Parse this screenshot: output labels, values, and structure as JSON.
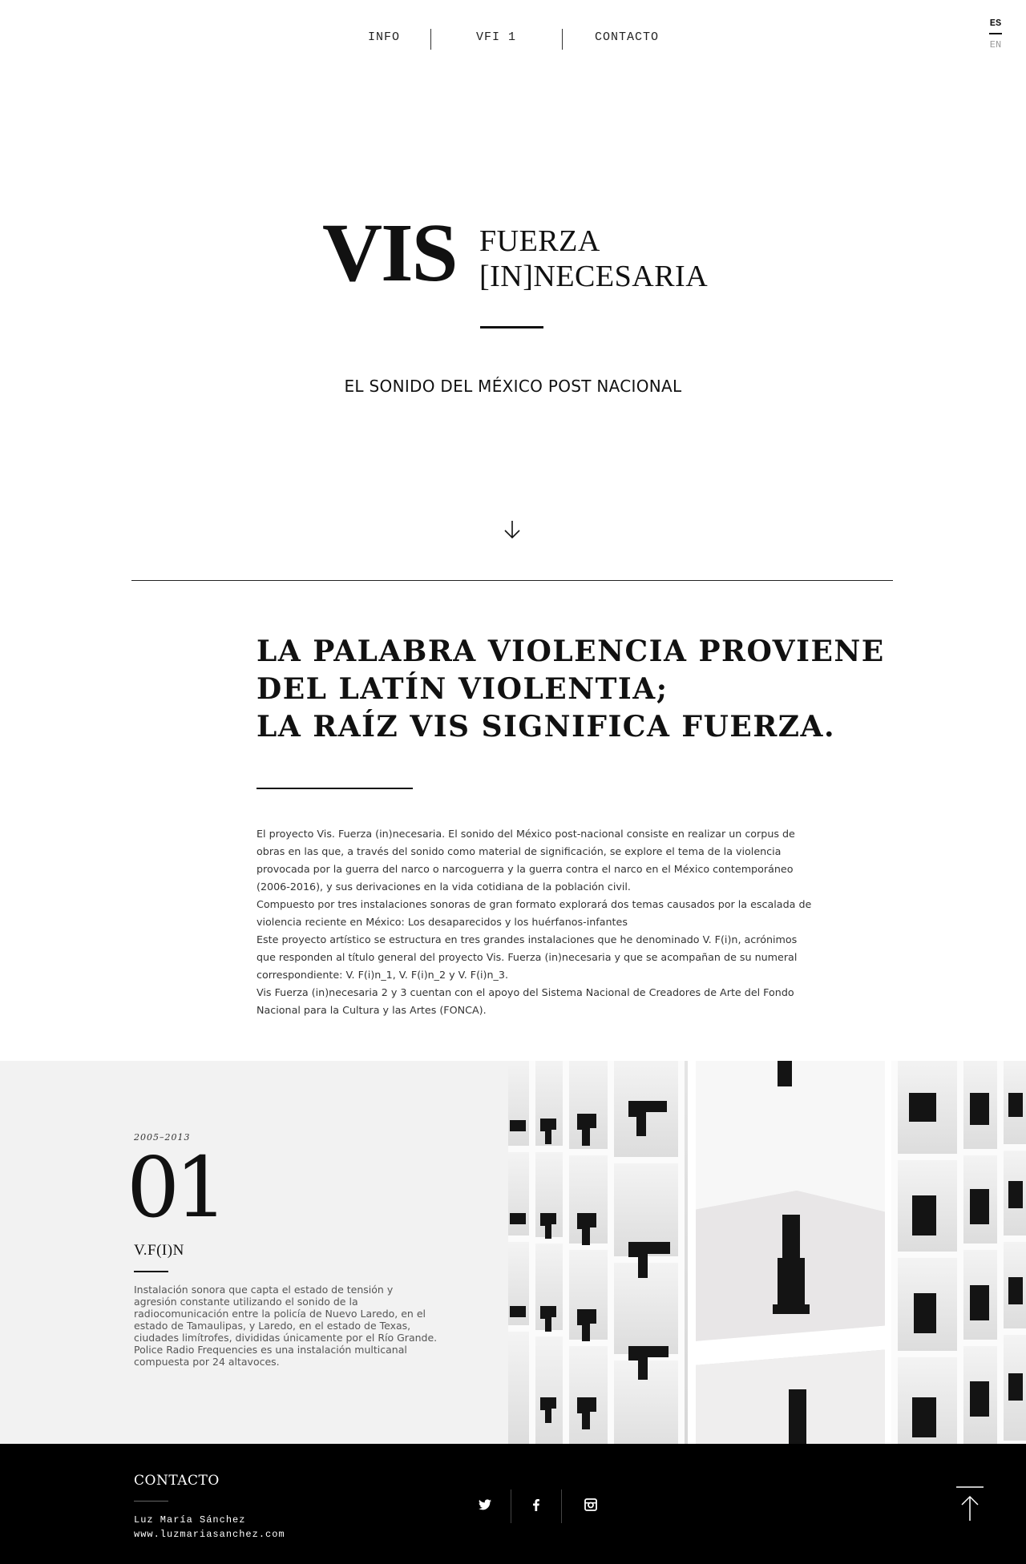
{
  "nav": {
    "items": [
      "INFO",
      "VFI 1",
      "CONTACTO"
    ]
  },
  "lang": {
    "active": "ES",
    "other": "EN"
  },
  "hero": {
    "vis": "VIS",
    "line1": "FUERZA",
    "line2": "[IN]NECESARIA",
    "tagline": "EL SONIDO DEL MÉXICO POST NACIONAL"
  },
  "quote": {
    "lines": [
      "LA PALABRA VIOLENCIA PROVIENE",
      "DEL LATÍN VIOLENTIA;",
      "LA RAÍZ VIS SIGNIFICA FUERZA."
    ]
  },
  "body": {
    "paragraphs": [
      "El proyecto Vis. Fuerza (in)necesaria. El sonido del México post-nacional consiste en realizar un corpus de obras en las que, a través del sonido como material de significación, se explore el tema de la violencia provocada por la guerra del narco o narcoguerra y la guerra contra el narco en el México contemporáneo (2006-2016), y sus derivaciones en la vida cotidiana de la población civil.",
      "Compuesto por tres instalaciones sonoras de gran formato explorará dos temas causados por la escalada de violencia reciente en México: Los desaparecidos y los huérfanos-infantes",
      "Este proyecto artístico se estructura en tres grandes instalaciones que he denominado V. F(i)n, acrónimos que responden al título general del proyecto Vis. Fuerza (in)necesaria y que se acompañan de su numeral correspondiente: V. F(i)n_1, V. F(i)n_2 y V. F(i)n_3.",
      "Vis Fuerza (in)necesaria 2 y 3 cuentan con el apoyo del Sistema Nacional de Creadores de Arte del Fondo Nacional para la Cultura y las Artes (FONCA)."
    ]
  },
  "project": {
    "years": "2005–2013",
    "number": "01",
    "title": "V.F(I)N",
    "description": "Instalación sonora que capta el estado de tensión y agresión constante utilizando el sonido de la radiocomunicación entre la policía de Nuevo Laredo, en el estado de Tamaulipas, y Laredo, en el estado de Texas, ciudades limítrofes, divididas únicamente por el Río Grande. Police Radio Frequencies es una instalación multicanal compuesta por 24 altavoces."
  },
  "footer": {
    "title": "CONTACTO",
    "name": "Luz María Sánchez",
    "url": "www.luzmariasanchez.com",
    "social": [
      "twitter-icon",
      "facebook-icon",
      "instagram-icon"
    ]
  },
  "colors": {
    "text": "#111111",
    "project_bg": "#f2f2f2",
    "footer_bg": "#000000"
  }
}
